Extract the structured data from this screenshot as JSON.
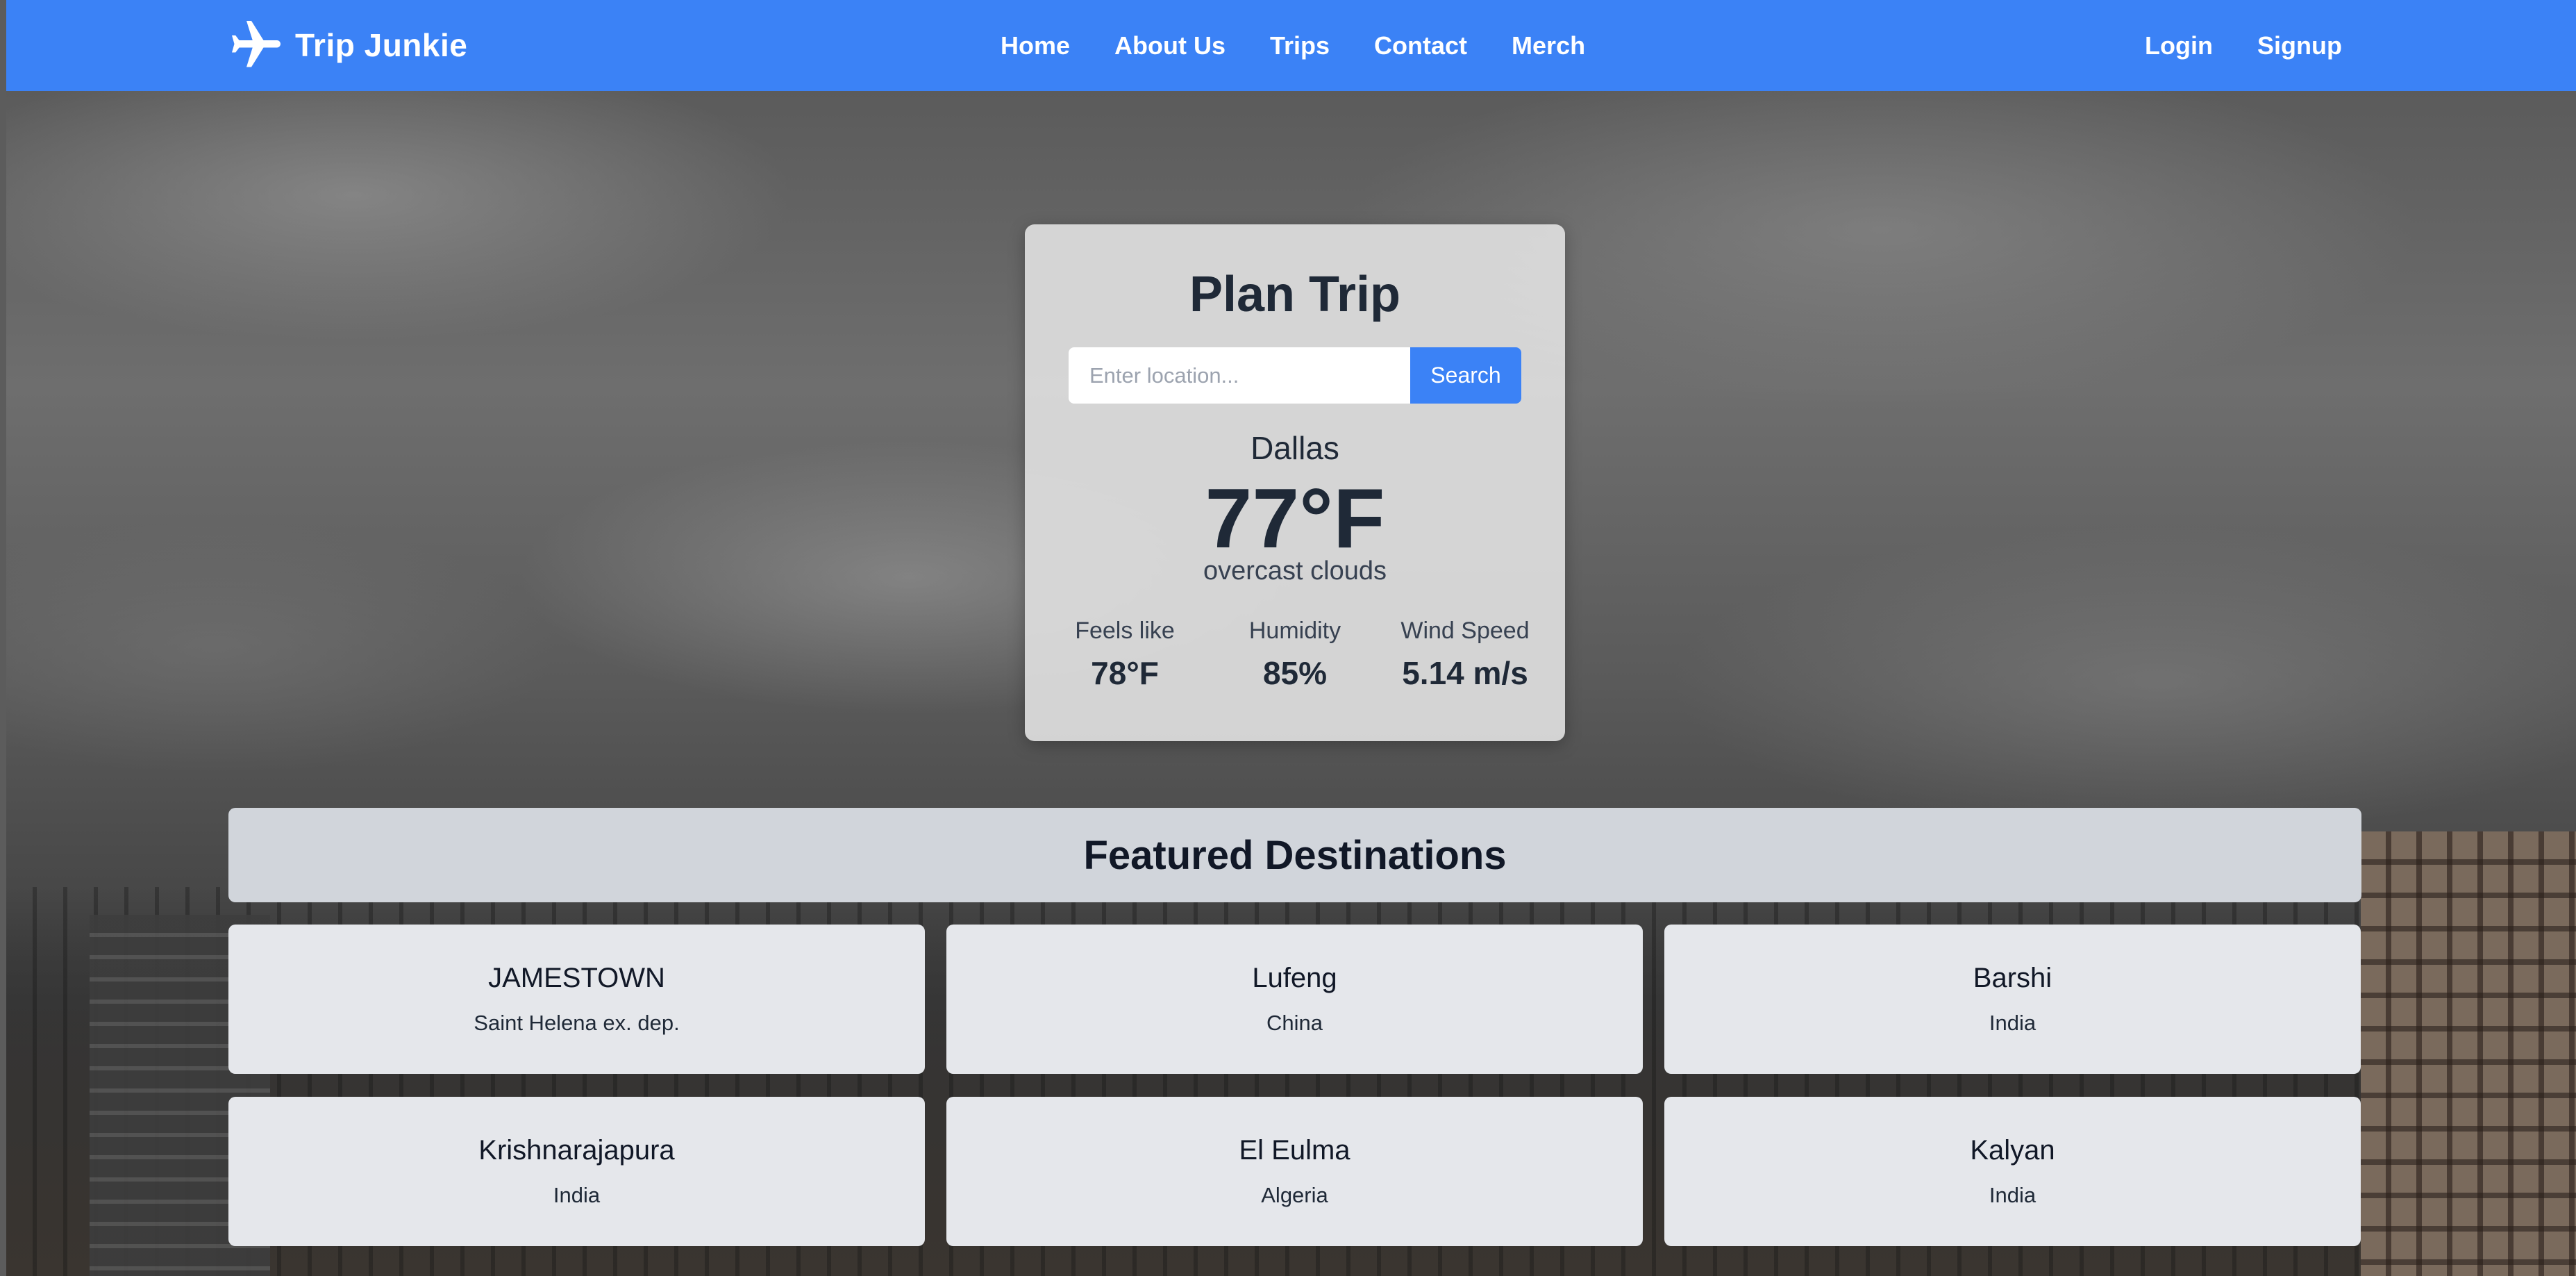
{
  "navbar": {
    "brand": "Trip Junkie",
    "links": [
      "Home",
      "About Us",
      "Trips",
      "Contact",
      "Merch"
    ],
    "auth": [
      "Login",
      "Signup"
    ]
  },
  "weather": {
    "title": "Plan Trip",
    "search_placeholder": "Enter location...",
    "search_button": "Search",
    "city": "Dallas",
    "temperature": "77°F",
    "description": "overcast clouds",
    "stats": [
      {
        "label": "Feels like",
        "value": "78°F"
      },
      {
        "label": "Humidity",
        "value": "85%"
      },
      {
        "label": "Wind Speed",
        "value": "5.14 m/s"
      }
    ]
  },
  "featured": {
    "title": "Featured Destinations",
    "destinations": [
      {
        "name": "JAMESTOWN",
        "country": "Saint Helena ex. dep."
      },
      {
        "name": "Lufeng",
        "country": "China"
      },
      {
        "name": "Barshi",
        "country": "India"
      },
      {
        "name": "Krishnarajapura",
        "country": "India"
      },
      {
        "name": "El Eulma",
        "country": "Algeria"
      },
      {
        "name": "Kalyan",
        "country": "India"
      }
    ]
  },
  "colors": {
    "primary": "#3b82f6",
    "card_bg": "#e5e7eb",
    "header_bg": "#d1d5db",
    "text_dark": "#1f2937"
  },
  "icons": {
    "brand": "airplane-icon"
  }
}
